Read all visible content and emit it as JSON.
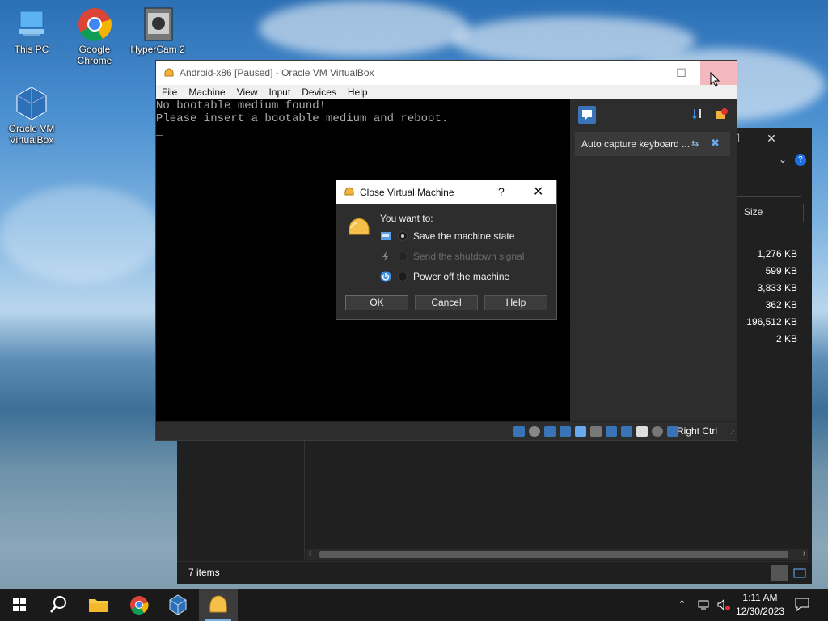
{
  "desktop": {
    "icons": [
      {
        "label": "This PC",
        "icon": "this-pc-icon"
      },
      {
        "label": "Google Chrome",
        "icon": "chrome-icon"
      },
      {
        "label": "HyperCam 2",
        "icon": "hypercam-icon"
      },
      {
        "label": "Oracle VM VirtualBox",
        "icon": "virtualbox-icon"
      }
    ]
  },
  "vbox": {
    "title": "Android-x86 [Paused] - Oracle VM VirtualBox",
    "menu": [
      "File",
      "Machine",
      "View",
      "Input",
      "Devices",
      "Help"
    ],
    "screen_lines": [
      "No bootable medium found!",
      "Please insert a bootable medium and reboot.",
      "_"
    ],
    "notification": "Auto capture keyboard ...",
    "host_key": "Right Ctrl",
    "colors": {
      "close_hover": "#f4b8bf",
      "screen_bg": "#000000"
    }
  },
  "dialog": {
    "title": "Close Virtual Machine",
    "help_glyph": "?",
    "prompt": "You want to:",
    "options": [
      {
        "label": "Save the machine state",
        "selected": true,
        "enabled": true,
        "icon": "save-state-icon"
      },
      {
        "label": "Send the shutdown signal",
        "selected": false,
        "enabled": false,
        "icon": "shutdown-signal-icon"
      },
      {
        "label": "Power off the machine",
        "selected": false,
        "enabled": true,
        "icon": "power-off-icon"
      }
    ],
    "buttons": {
      "ok": "OK",
      "cancel": "Cancel",
      "help": "Help"
    }
  },
  "explorer": {
    "size_header": "Size",
    "sizes": [
      "1,276 KB",
      "599 KB",
      "3,833 KB",
      "362 KB",
      "196,512 KB",
      "2 KB"
    ],
    "status": "7 items"
  },
  "taskbar": {
    "time": "1:11 AM",
    "date": "12/30/2023",
    "pinned": [
      "start-icon",
      "search-icon",
      "file-explorer-icon",
      "chrome-icon",
      "virtualbox-icon",
      "virtualbox-vm-icon"
    ]
  }
}
